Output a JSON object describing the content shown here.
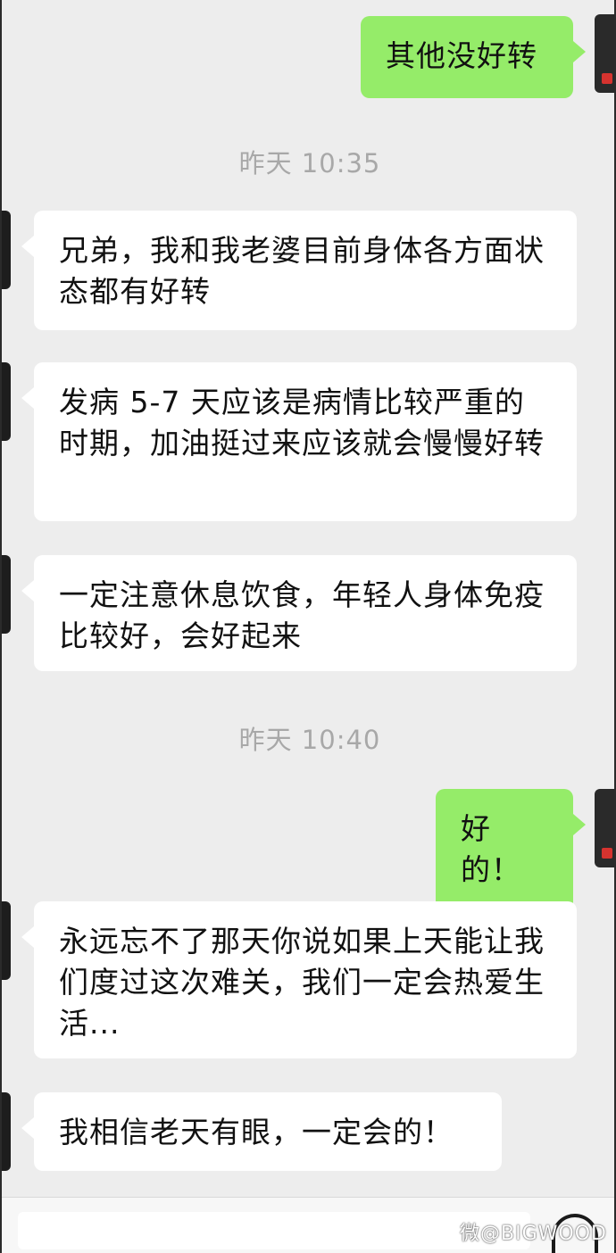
{
  "chat": {
    "timestamps": [
      "昨天 10:35",
      "昨天 10:40"
    ],
    "messages": [
      {
        "side": "right",
        "text": "其他没好转"
      },
      {
        "side": "left",
        "text": "兄弟，我和我老婆目前身体各方面状态都有好转"
      },
      {
        "side": "left",
        "text": "发病 5-7 天应该是病情比较严重的时期，加油挺过来应该就会慢慢好转"
      },
      {
        "side": "left",
        "text": "一定注意休息饮食，年轻人身体免疫比较好，会好起来"
      },
      {
        "side": "right",
        "text": "好的！"
      },
      {
        "side": "left",
        "text": "永远忘不了那天你说如果上天能让我们度过这次难关，我们一定会热爱生活..."
      },
      {
        "side": "left",
        "text": "我相信老天有眼，一定会的！"
      }
    ]
  },
  "colors": {
    "background": "#ededed",
    "incoming_bubble": "#ffffff",
    "outgoing_bubble": "#95ec69"
  },
  "icons": {
    "voice": "voice-icon",
    "avatar": "avatar"
  },
  "watermark": "微@BIGWOOD"
}
